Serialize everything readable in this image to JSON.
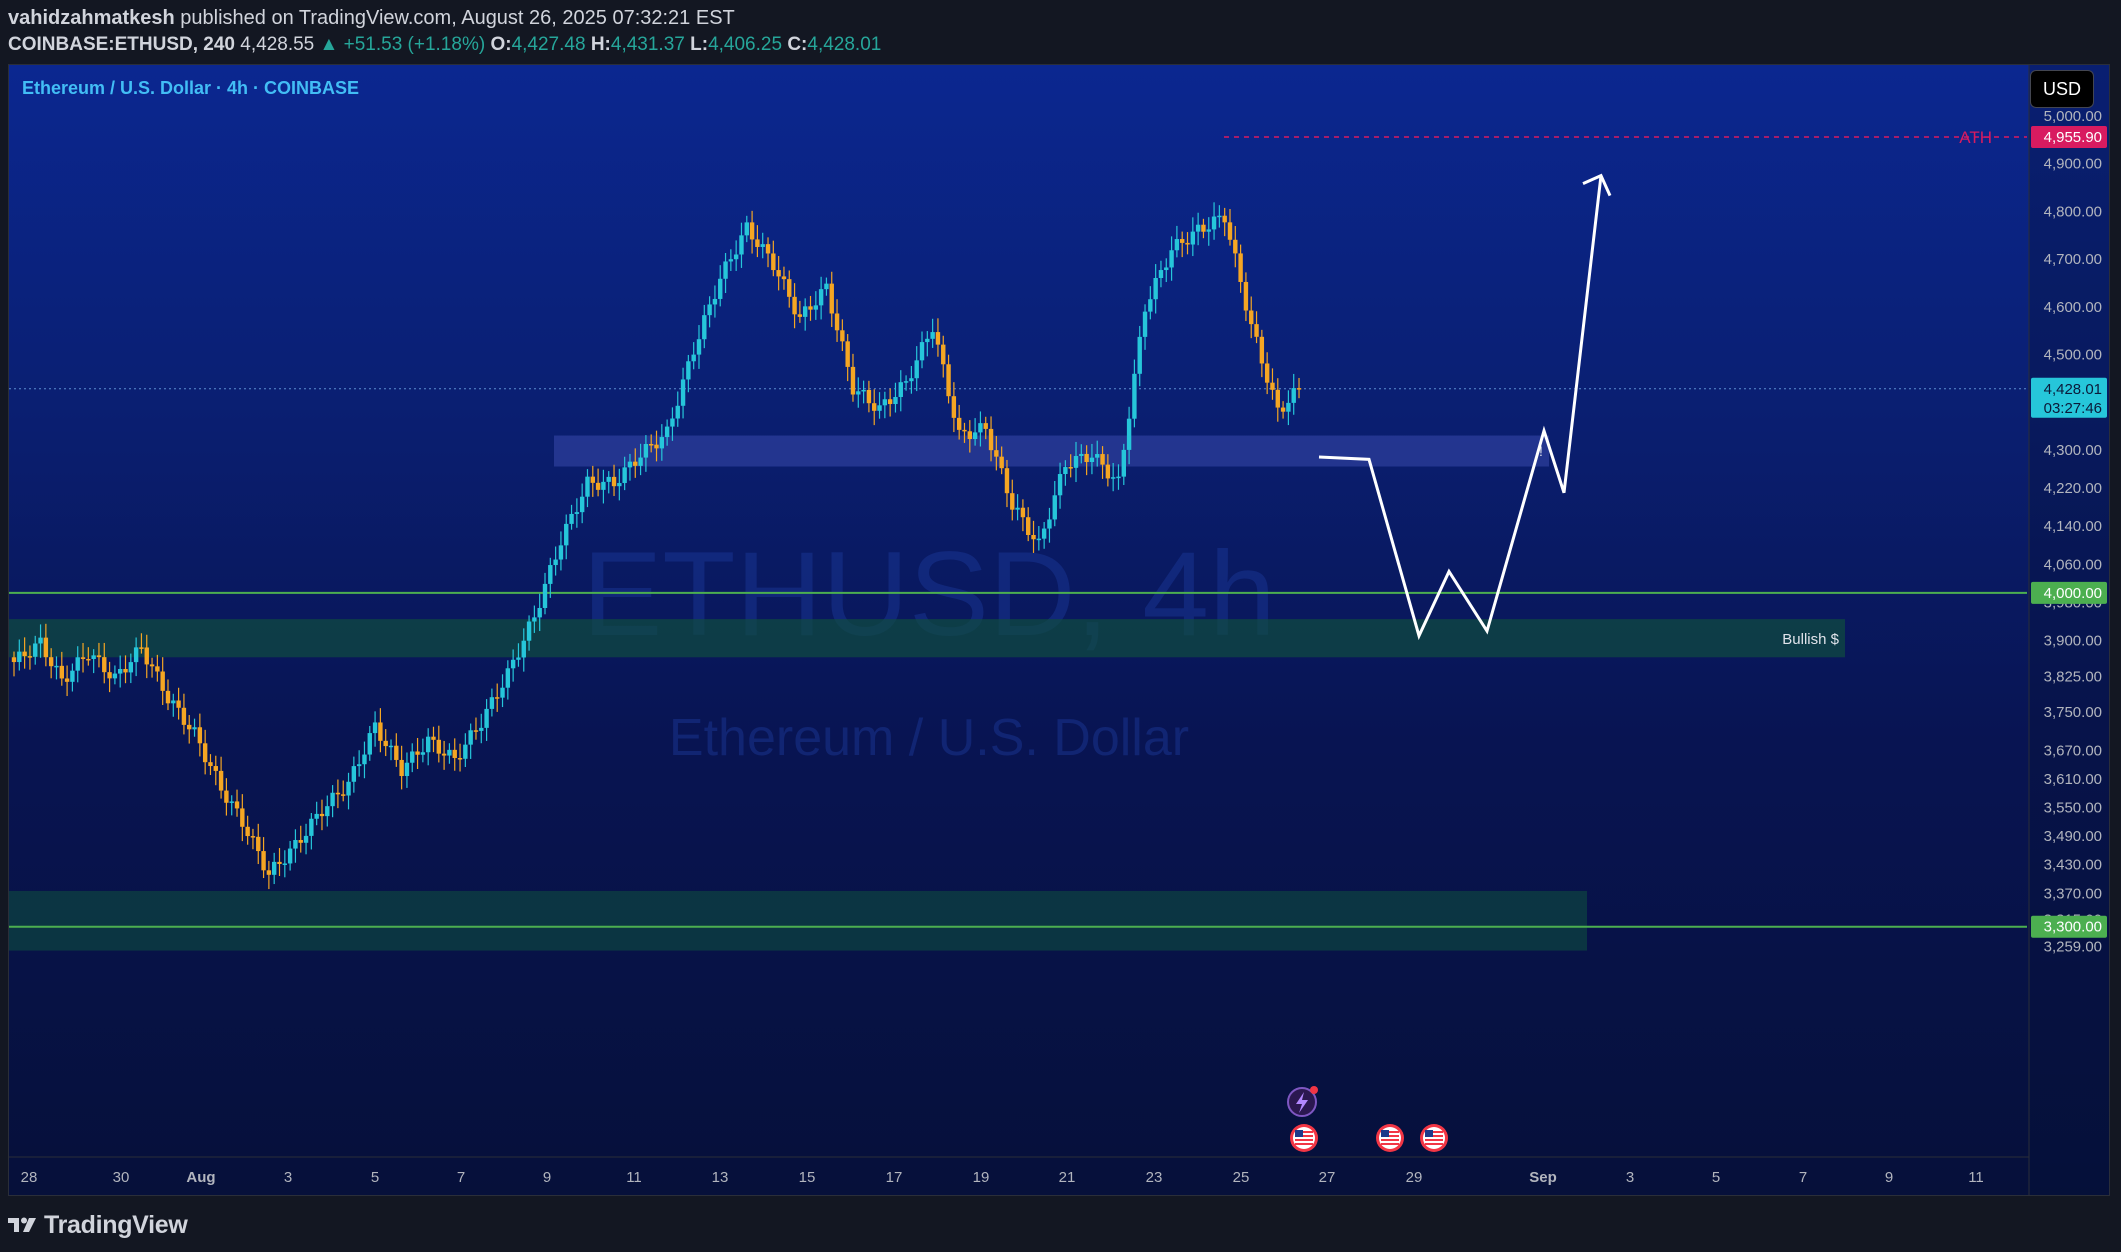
{
  "header": {
    "author": "vahidzahmatkesh",
    "published_text": "published on TradingView.com, August 26, 2025 07:32:21 EST",
    "symbol": "COINBASE:ETHUSD, 240",
    "last": "4,428.55",
    "change": "▲ +51.53 (+1.18%)",
    "o_label": "O:",
    "o": "4,427.48",
    "h_label": "H:",
    "h": "4,431.37",
    "l_label": "L:",
    "l": "4,406.25",
    "c_label": "C:",
    "c": "4,428.01"
  },
  "chart_title": "Ethereum / U.S. Dollar · 4h · COINBASE",
  "currency": "USD",
  "watermark": {
    "line1": "ETHUSD, 4h",
    "line2": "Ethereum / U.S. Dollar"
  },
  "brand": "TradingView",
  "colors": {
    "up": "#26c6da",
    "down": "#f5a623",
    "ath": "#d81b60",
    "support": "#4caf50",
    "resistance_zone": "#3f51b5"
  },
  "annotations": {
    "ath_label": "ATH",
    "bullish_label": "Bullish $",
    "exclaim": "!"
  },
  "chart_data": {
    "type": "candlestick",
    "title": "Ethereum / U.S. Dollar · 4h · COINBASE",
    "ylim": [
      3220,
      5080
    ],
    "y_ticks": [
      3259,
      3315,
      3370,
      3430,
      3490,
      3550,
      3610,
      3670,
      3750,
      3825,
      3900,
      3980,
      4060,
      4140,
      4220,
      4300,
      4500,
      4600,
      4700,
      4800,
      4900,
      5000
    ],
    "y_tick_labels": [
      "3,259.00",
      "3,315.00",
      "3,370.00",
      "3,430.00",
      "3,490.00",
      "3,550.00",
      "3,610.00",
      "3,670.00",
      "3,750.00",
      "3,825.00",
      "3,900.00",
      "3,980.00",
      "4,060.00",
      "4,140.00",
      "4,220.00",
      "4,300.00",
      "4,500.00",
      "4,600.00",
      "4,700.00",
      "4,800.00",
      "4,900.00",
      "5,000.00"
    ],
    "x_labels": [
      "28",
      "30",
      "Aug",
      "3",
      "5",
      "7",
      "9",
      "11",
      "13",
      "15",
      "17",
      "19",
      "21",
      "23",
      "25",
      "27",
      "29",
      "Sep",
      "3",
      "5",
      "7",
      "9",
      "11"
    ],
    "price_badges": [
      {
        "label": "4,955.90",
        "value": 4955.9,
        "color": "#d81b60"
      },
      {
        "label": "4,428.01",
        "sublabel": "03:27:46",
        "value": 4428.01,
        "color": "#26c6da"
      },
      {
        "label": "4,000.00",
        "value": 4000,
        "color": "#4caf50"
      },
      {
        "label": "3,300.00",
        "value": 3300,
        "color": "#4caf50"
      }
    ],
    "levels": {
      "ath": 4955.9,
      "support_1": 4000,
      "support_2": 3300,
      "current": 4428.01
    },
    "zones": [
      {
        "name": "resistance",
        "from": 4265,
        "to": 4330
      },
      {
        "name": "bullish",
        "from": 3865,
        "to": 3945
      },
      {
        "name": "bottom",
        "from": 3250,
        "to": 3375
      }
    ],
    "anchor_closes": [
      [
        0,
        3855
      ],
      [
        5,
        3895
      ],
      [
        9,
        3815
      ],
      [
        14,
        3875
      ],
      [
        19,
        3820
      ],
      [
        24,
        3885
      ],
      [
        29,
        3780
      ],
      [
        34,
        3705
      ],
      [
        39,
        3590
      ],
      [
        43,
        3520
      ],
      [
        48,
        3410
      ],
      [
        53,
        3470
      ],
      [
        58,
        3545
      ],
      [
        63,
        3600
      ],
      [
        68,
        3720
      ],
      [
        73,
        3630
      ],
      [
        78,
        3690
      ],
      [
        83,
        3650
      ],
      [
        88,
        3730
      ],
      [
        93,
        3830
      ],
      [
        98,
        3950
      ],
      [
        103,
        4110
      ],
      [
        108,
        4230
      ],
      [
        113,
        4230
      ],
      [
        118,
        4290
      ],
      [
        123,
        4335
      ],
      [
        128,
        4510
      ],
      [
        133,
        4660
      ],
      [
        138,
        4765
      ],
      [
        143,
        4690
      ],
      [
        148,
        4575
      ],
      [
        153,
        4640
      ],
      [
        158,
        4430
      ],
      [
        163,
        4385
      ],
      [
        168,
        4440
      ],
      [
        173,
        4560
      ],
      [
        178,
        4330
      ],
      [
        183,
        4345
      ],
      [
        188,
        4185
      ],
      [
        193,
        4100
      ],
      [
        198,
        4270
      ],
      [
        203,
        4290
      ],
      [
        208,
        4230
      ],
      [
        213,
        4600
      ],
      [
        218,
        4720
      ],
      [
        223,
        4760
      ],
      [
        228,
        4790
      ],
      [
        233,
        4560
      ],
      [
        238,
        4380
      ],
      [
        242,
        4428
      ]
    ],
    "forecast_path": [
      [
        4285,
        0
      ],
      [
        4280,
        1
      ],
      [
        3910,
        2
      ],
      [
        4045,
        3
      ],
      [
        3920,
        4
      ],
      [
        4340,
        5
      ],
      [
        4210,
        6
      ],
      [
        4875,
        7
      ]
    ]
  }
}
